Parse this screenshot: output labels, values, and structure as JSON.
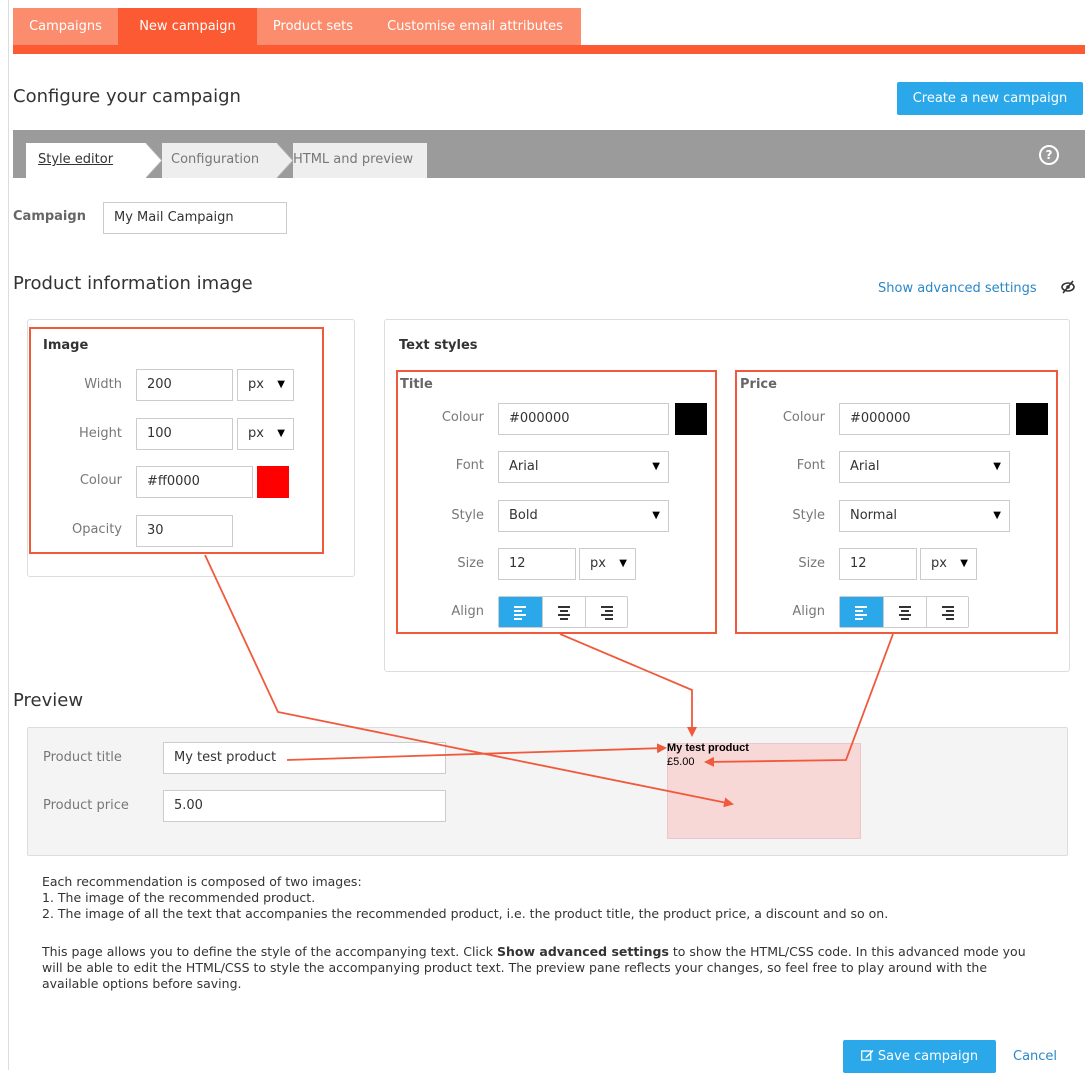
{
  "top_tabs": [
    "Campaigns",
    "New campaign",
    "Product sets",
    "Customise email attributes"
  ],
  "page_title": "Configure your campaign",
  "create_button": "Create a new campaign",
  "steps": [
    "Style editor",
    "Configuration",
    "HTML and preview"
  ],
  "campaign": {
    "label": "Campaign",
    "value": "My Mail Campaign"
  },
  "section_title": "Product information image",
  "advanced_link": "Show advanced settings",
  "image_panel": {
    "title": "Image",
    "width_label": "Width",
    "width_value": "200",
    "width_unit": "px",
    "height_label": "Height",
    "height_value": "100",
    "height_unit": "px",
    "colour_label": "Colour",
    "colour_value": "#ff0000",
    "opacity_label": "Opacity",
    "opacity_value": "30"
  },
  "text_styles": {
    "title": "Text styles",
    "title_group": {
      "heading": "Title",
      "colour_label": "Colour",
      "colour_value": "#000000",
      "font_label": "Font",
      "font_value": "Arial",
      "style_label": "Style",
      "style_value": "Bold",
      "size_label": "Size",
      "size_value": "12",
      "size_unit": "px",
      "align_label": "Align"
    },
    "price_group": {
      "heading": "Price",
      "colour_label": "Colour",
      "colour_value": "#000000",
      "font_label": "Font",
      "font_value": "Arial",
      "style_label": "Style",
      "style_value": "Normal",
      "size_label": "Size",
      "size_value": "12",
      "size_unit": "px",
      "align_label": "Align"
    }
  },
  "preview": {
    "heading": "Preview",
    "product_title_label": "Product title",
    "product_title_value": "My test product",
    "product_price_label": "Product price",
    "product_price_value": "5.00",
    "render_title": "My test product",
    "render_price": "£5.00"
  },
  "description": {
    "line1": "Each recommendation is composed of two images:",
    "line2": "1. The image of the recommended product.",
    "line3": "2. The image of all the text that accompanies the recommended product, i.e. the product title, the product price, a discount and so on.",
    "para2_a": "This page allows you to define the style of the accompanying text. Click ",
    "para2_bold": "Show advanced settings",
    "para2_b": " to show the HTML/CSS code. In this advanced mode you will be able to edit the HTML/CSS to style the accompanying product text. The preview pane reflects your changes, so feel free to play around with the available options before saving."
  },
  "save_button": "Save campaign",
  "cancel_link": "Cancel",
  "colors": {
    "accent": "#fb5a33",
    "tab_light": "#fb8d6e",
    "primary": "#2aa8ea",
    "highlight": "#f05a3c",
    "image_colour": "#ff0000",
    "text_colour": "#000000"
  }
}
